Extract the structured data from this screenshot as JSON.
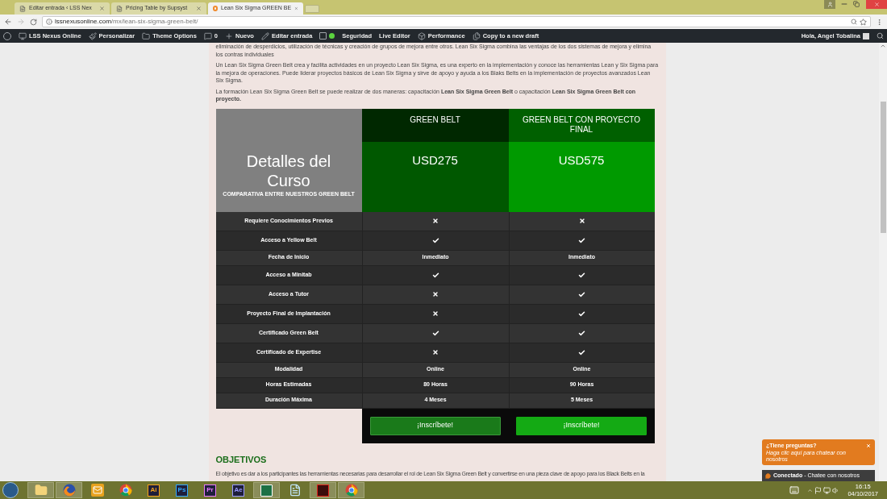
{
  "browser": {
    "tabs": [
      {
        "title": "Editar entrada ‹ LSS Nex",
        "selected": false
      },
      {
        "title": "Pricing Table by Supsyst",
        "selected": false
      },
      {
        "title": "Lean Six Sigma GREEN BE",
        "selected": true
      }
    ],
    "url_host": "lssnexusonline.com",
    "url_path": "/mx/lean-six-sigma-green-belt/"
  },
  "admin_bar": {
    "items": [
      {
        "kind": "site",
        "label": "LSS Nexus Online"
      },
      {
        "kind": "brush",
        "label": "Personalizar"
      },
      {
        "kind": "theme",
        "label": "Theme Options"
      },
      {
        "kind": "comments",
        "label": "0"
      },
      {
        "kind": "new",
        "label": "Nuevo"
      },
      {
        "kind": "edit",
        "label": "Editar entrada"
      },
      {
        "kind": "seo"
      },
      {
        "kind": "plain",
        "label": "Seguridad"
      },
      {
        "kind": "plain",
        "label": "Live Editor"
      },
      {
        "kind": "performance",
        "label": "Performance"
      },
      {
        "kind": "copy",
        "label": "Copy to a new draft"
      }
    ],
    "greeting": "Hola, Angel Tobalina"
  },
  "article": {
    "paragraphs": [
      "eliminación de desperdicios, utilización de técnicas y creación de grupos de mejora entre otros. Lean Six Sigma combina las ventajas de los dos sistemas de mejora y elimina los contras individuales",
      "Un Lean Six Sigma Green Belt crea y facilita actividades en un proyecto Lean Six Sigma, es una experto en la implementación y conoce las herramientas Lean y Six Sigma para la mejora de operaciones. Puede liderar proyectos básicos de Lean Six Sigma y sirve de apoyo y ayuda a los Blaks Belts en la implementación de proyectos avanzados Lean Six Sigma.",
      "La formación Lean Six Sigma Green Belt se puede realizar de dos maneras: capacitación **Lean Six Sigma Green Belt** o capacitación **Lean Six Sigma Green Belt con proyecto.**"
    ],
    "pricing_table": {
      "title": "Detalles del Curso",
      "subtitle": "COMPARATIVA ENTRE NUESTROS GREEN BELT",
      "plans": [
        {
          "name": "GREEN BELT",
          "price": "USD275",
          "featured": false,
          "button": "¡Inscríbete!"
        },
        {
          "name": "GREEN BELT CON PROYECTO FINAL",
          "price": "USD575",
          "featured": true,
          "button": "¡Inscríbete!"
        }
      ],
      "rows": [
        {
          "label": "Requiere Conocimientos Previos",
          "values": [
            {
              "kind": "cross"
            },
            {
              "kind": "cross"
            }
          ]
        },
        {
          "label": "Acceso a Yellow Belt",
          "values": [
            {
              "kind": "check"
            },
            {
              "kind": "check"
            }
          ]
        },
        {
          "label": "Fecha de Inicio",
          "values": [
            {
              "kind": "text",
              "text": "Inmediato"
            },
            {
              "kind": "text",
              "text": "Inmediato"
            }
          ]
        },
        {
          "label": "Acceso a Minitab",
          "values": [
            {
              "kind": "check"
            },
            {
              "kind": "check"
            }
          ]
        },
        {
          "label": "Acceso a Tutor",
          "values": [
            {
              "kind": "cross"
            },
            {
              "kind": "check"
            }
          ]
        },
        {
          "label": "Proyecto Final de Implantación",
          "values": [
            {
              "kind": "cross"
            },
            {
              "kind": "check"
            }
          ]
        },
        {
          "label": "Certificado Green Belt",
          "values": [
            {
              "kind": "check"
            },
            {
              "kind": "check"
            }
          ]
        },
        {
          "label": "Certificado de Expertise",
          "values": [
            {
              "kind": "cross"
            },
            {
              "kind": "check"
            }
          ]
        },
        {
          "label": "Modalidad",
          "values": [
            {
              "kind": "text",
              "text": "Online"
            },
            {
              "kind": "text",
              "text": "Online"
            }
          ]
        },
        {
          "label": "Horas Estimadas",
          "values": [
            {
              "kind": "text",
              "text": "80 Horas"
            },
            {
              "kind": "text",
              "text": "90 Horas"
            }
          ]
        },
        {
          "label": "Duración Máxima",
          "values": [
            {
              "kind": "text",
              "text": "4 Meses"
            },
            {
              "kind": "text",
              "text": "5 Meses"
            }
          ]
        }
      ]
    },
    "section_heading": "OBJETIVOS",
    "section_text": "El objetivo es dar a los participantes las herramientas necesarias para desarrollar el rol de Lean Six Sigma Green Belt y convertirse en una pieza clave de apoyo para los Black Belts en la"
  },
  "chat": {
    "title": "¿Tiene preguntas?",
    "subtitle": "Haga clic aquí para chatear con nosotros",
    "status": "Conectado",
    "status_text": "- Chatee con nosotros"
  },
  "taskbar": {
    "apps": [
      {
        "kind": "folder",
        "active": true
      },
      {
        "kind": "firefox",
        "active": true
      },
      {
        "kind": "outlook",
        "active": false
      },
      {
        "kind": "chrome",
        "active": false
      },
      {
        "kind": "badge",
        "label": "Ai",
        "color": "#f7a21b",
        "active": false
      },
      {
        "kind": "badge",
        "label": "Ps",
        "color": "#31a8ff",
        "active": false
      },
      {
        "kind": "badge",
        "label": "Pr",
        "color": "#ea77ff",
        "active": false
      },
      {
        "kind": "badge",
        "label": "Ae",
        "color": "#9999ff",
        "active": false
      },
      {
        "kind": "excel",
        "active": true
      },
      {
        "kind": "notepad",
        "active": false
      },
      {
        "kind": "acrobat",
        "active": true
      },
      {
        "kind": "chrome",
        "active": true
      }
    ],
    "time": "16:15",
    "date": "04/10/2017"
  }
}
